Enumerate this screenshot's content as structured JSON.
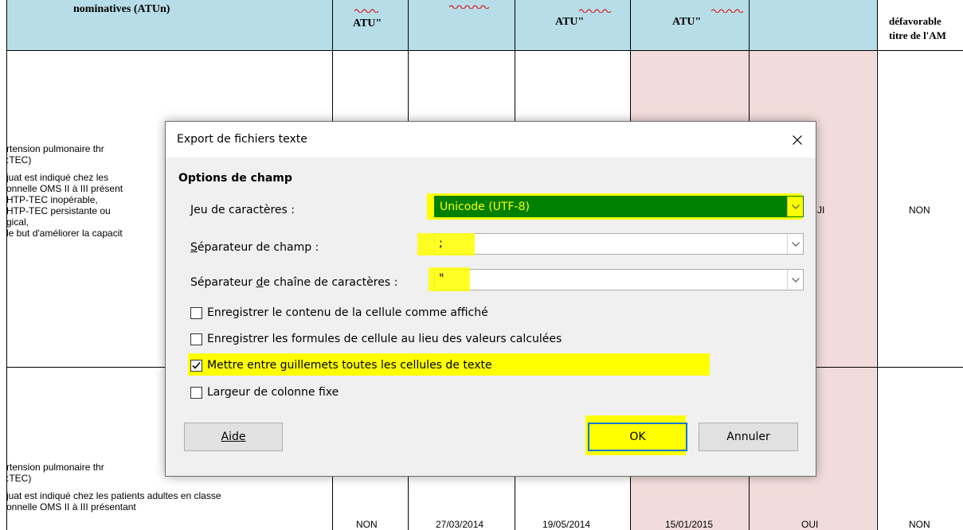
{
  "sheet": {
    "header": {
      "col1": "nominatives (ATUn)",
      "col2": "ATU\"",
      "col4": "ATU\"",
      "col5": "ATU\"",
      "col7_line1": "défavorable",
      "col7_line2": "titre de l'AM"
    },
    "row1_text": [
      "rtension   pulmonaire   thr",
      ":TEC)",
      "",
      "juat  est  indiqué  chez  les",
      "onnelle OMS II à III présent",
      "HTP-TEC inopérable,",
      " HTP-TEC  persistante  ou",
      "gical,",
      "le but d'améliorer la capacit"
    ],
    "row1_values": {
      "col6": "JI",
      "col7": "NON"
    },
    "row2_text": [
      "rtension   pulmonaire   thr",
      ":TEC)",
      "",
      "juat  est  indiqué  chez  les  patients  adultes  en  classe",
      "onnelle OMS II à III présentant"
    ],
    "row2_values": {
      "col2": "NON",
      "col3": "27/03/2014",
      "col4": "19/05/2014",
      "col5": "15/01/2015",
      "col6": "OUI",
      "col7": "NON"
    }
  },
  "dialog": {
    "title": "Export de fichiers texte",
    "section": "Options de champ",
    "charset": {
      "label": "Jeu de caractères :",
      "value": "Unicode (UTF-8)"
    },
    "field_separator": {
      "label": "Séparateur de champ :",
      "value": ";"
    },
    "string_delimiter": {
      "label": "Séparateur de chaîne de caractères :",
      "value": "\""
    },
    "checkboxes": [
      {
        "label": "Enregistrer le contenu de la cellule comme affiché",
        "checked": false
      },
      {
        "label": "Enregistrer les formules de cellule au lieu des valeurs calculées",
        "checked": false
      },
      {
        "label": "Mettre entre guillemets toutes les cellules de texte",
        "checked": true
      },
      {
        "label": "Largeur de colonne fixe",
        "checked": false
      }
    ],
    "buttons": {
      "help": "Aide",
      "ok": "OK",
      "cancel": "Annuler"
    },
    "colors": {
      "highlight": "#ffff00",
      "charset_bg": "#008000",
      "ok_border": "#0078d7"
    }
  }
}
